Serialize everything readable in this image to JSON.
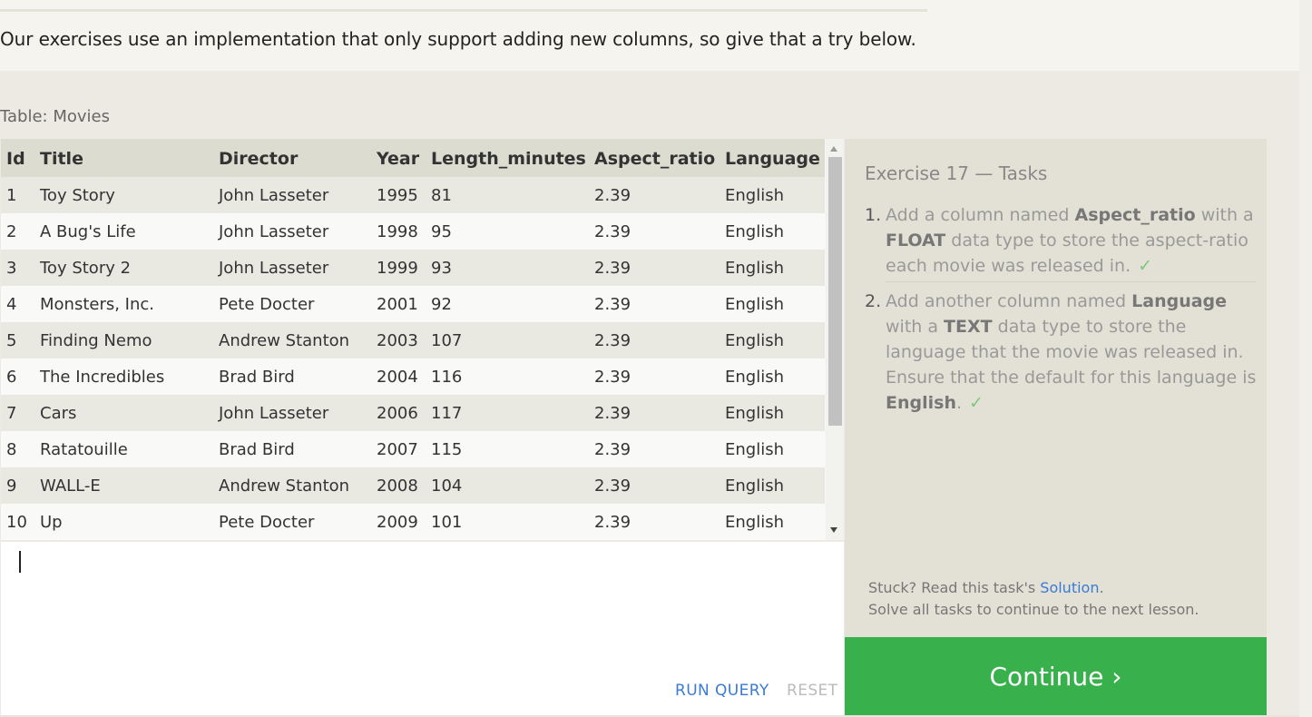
{
  "intro_text": "Our exercises use an implementation that only support adding new columns, so give that a try below.",
  "table_caption": "Table: Movies",
  "table": {
    "columns": [
      "Id",
      "Title",
      "Director",
      "Year",
      "Length_minutes",
      "Aspect_ratio",
      "Language"
    ],
    "rows": [
      [
        "1",
        "Toy Story",
        "John Lasseter",
        "1995",
        "81",
        "2.39",
        "English"
      ],
      [
        "2",
        "A Bug's Life",
        "John Lasseter",
        "1998",
        "95",
        "2.39",
        "English"
      ],
      [
        "3",
        "Toy Story 2",
        "John Lasseter",
        "1999",
        "93",
        "2.39",
        "English"
      ],
      [
        "4",
        "Monsters, Inc.",
        "Pete Docter",
        "2001",
        "92",
        "2.39",
        "English"
      ],
      [
        "5",
        "Finding Nemo",
        "Andrew Stanton",
        "2003",
        "107",
        "2.39",
        "English"
      ],
      [
        "6",
        "The Incredibles",
        "Brad Bird",
        "2004",
        "116",
        "2.39",
        "English"
      ],
      [
        "7",
        "Cars",
        "John Lasseter",
        "2006",
        "117",
        "2.39",
        "English"
      ],
      [
        "8",
        "Ratatouille",
        "Brad Bird",
        "2007",
        "115",
        "2.39",
        "English"
      ],
      [
        "9",
        "WALL-E",
        "Andrew Stanton",
        "2008",
        "104",
        "2.39",
        "English"
      ],
      [
        "10",
        "Up",
        "Pete Docter",
        "2009",
        "101",
        "2.39",
        "English"
      ]
    ]
  },
  "editor": {
    "query_text": "",
    "run_label": "RUN QUERY",
    "reset_label": "RESET"
  },
  "tasks_panel": {
    "title": "Exercise 17 — Tasks",
    "tasks": [
      {
        "number": "1.",
        "parts": [
          "Add a column named ",
          "Aspect_ratio",
          " with a ",
          "FLOAT",
          " data type to store the aspect-ratio each movie was released in."
        ],
        "check": "✓"
      },
      {
        "number": "2.",
        "parts": [
          "Add another column named ",
          "Language",
          " with a ",
          "TEXT",
          " data type to store the language that the movie was released in. Ensure that the default for this language is ",
          "English",
          "."
        ],
        "check": "✓"
      }
    ],
    "stuck_prefix": "Stuck? Read this task's ",
    "solution_link": "Solution",
    "stuck_suffix": ".",
    "solve_all_text": "Solve all tasks to continue to the next lesson."
  },
  "continue_label": "Continue ›",
  "colors": {
    "continue_bg": "#38b04b",
    "link": "#3a7bd5",
    "check": "#7dc77d"
  }
}
